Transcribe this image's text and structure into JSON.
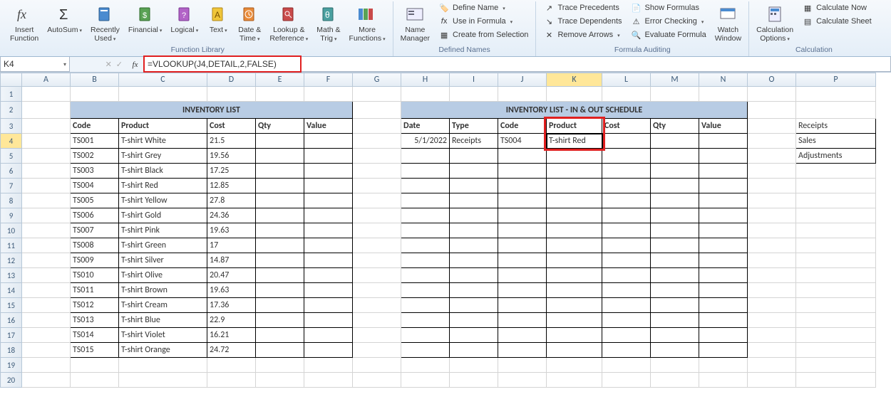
{
  "ribbon": {
    "groups": {
      "function_library": {
        "title": "Function Library",
        "insert_function": "Insert\nFunction",
        "autosum": "AutoSum",
        "recently": "Recently\nUsed",
        "financial": "Financial",
        "logical": "Logical",
        "text": "Text",
        "date_time": "Date &\nTime",
        "lookup": "Lookup &\nReference",
        "math": "Math &\nTrig",
        "more": "More\nFunctions"
      },
      "defined_names": {
        "title": "Defined Names",
        "name_manager": "Name\nManager",
        "define_name": "Define Name",
        "use_in_formula": "Use in Formula",
        "create_from_selection": "Create from Selection"
      },
      "formula_auditing": {
        "title": "Formula Auditing",
        "trace_precedents": "Trace Precedents",
        "trace_dependents": "Trace Dependents",
        "remove_arrows": "Remove Arrows",
        "show_formulas": "Show Formulas",
        "error_checking": "Error Checking",
        "evaluate_formula": "Evaluate Formula",
        "watch_window": "Watch\nWindow"
      },
      "calculation": {
        "title": "Calculation",
        "calc_options": "Calculation\nOptions",
        "calc_now": "Calculate Now",
        "calc_sheet": "Calculate Sheet"
      }
    }
  },
  "formula_bar": {
    "cell_ref": "K4",
    "formula": "=VLOOKUP(J4,DETAIL,2,FALSE)"
  },
  "columns": [
    "A",
    "B",
    "C",
    "D",
    "E",
    "F",
    "G",
    "H",
    "I",
    "J",
    "K",
    "L",
    "M",
    "N",
    "O",
    "P"
  ],
  "inventory": {
    "title": "INVENTORY LIST",
    "headers": {
      "code": "Code",
      "product": "Product",
      "cost": "Cost",
      "qty": "Qty",
      "value": "Value"
    },
    "rows": [
      {
        "code": "TS001",
        "product": "T-shirt White",
        "cost": "21.5"
      },
      {
        "code": "TS002",
        "product": "T-shirt Grey",
        "cost": "19.56"
      },
      {
        "code": "TS003",
        "product": "T-shirt Black",
        "cost": "17.25"
      },
      {
        "code": "TS004",
        "product": "T-shirt Red",
        "cost": "12.85"
      },
      {
        "code": "TS005",
        "product": "T-shirt Yellow",
        "cost": "27.8"
      },
      {
        "code": "TS006",
        "product": "T-shirt Gold",
        "cost": "24.36"
      },
      {
        "code": "TS007",
        "product": "T-shirt Pink",
        "cost": "19.63"
      },
      {
        "code": "TS008",
        "product": "T-shirt Green",
        "cost": "17"
      },
      {
        "code": "TS009",
        "product": "T-shirt Silver",
        "cost": "14.87"
      },
      {
        "code": "TS010",
        "product": "T-shirt Olive",
        "cost": "20.47"
      },
      {
        "code": "TS011",
        "product": "T-shirt Brown",
        "cost": "19.63"
      },
      {
        "code": "TS012",
        "product": "T-shirt Cream",
        "cost": "17.36"
      },
      {
        "code": "TS013",
        "product": "T-shirt Blue",
        "cost": "22.9"
      },
      {
        "code": "TS014",
        "product": "T-shirt Violet",
        "cost": "16.21"
      },
      {
        "code": "TS015",
        "product": "T-shirt Orange",
        "cost": "24.72"
      }
    ]
  },
  "schedule": {
    "title": "INVENTORY LIST - IN & OUT SCHEDULE",
    "headers": {
      "date": "Date",
      "type": "Type",
      "code": "Code",
      "product": "Product",
      "cost": "Cost",
      "qty": "Qty",
      "value": "Value"
    },
    "row": {
      "date": "5/1/2022",
      "type": "Receipts",
      "code": "TS004",
      "product": "T-shirt Red"
    }
  },
  "side_list": {
    "receipts": "Receipts",
    "sales": "Sales",
    "adjustments": "Adjustments"
  }
}
